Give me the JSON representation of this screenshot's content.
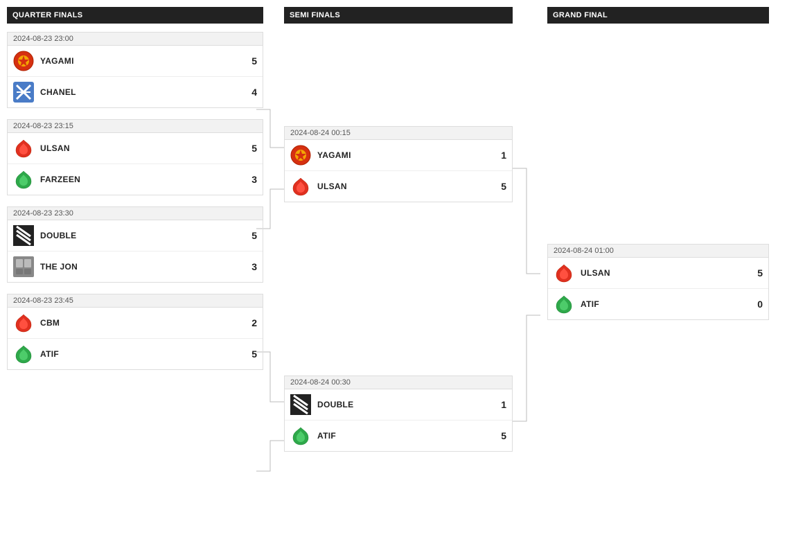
{
  "rounds": {
    "qf": {
      "label": "Quarter Finals",
      "matches": [
        {
          "time": "2024-08-23 23:00",
          "teams": [
            {
              "name": "YAGAMI",
              "score": "5",
              "logo": "yagami"
            },
            {
              "name": "CHANEL",
              "score": "4",
              "logo": "chanel"
            }
          ]
        },
        {
          "time": "2024-08-23 23:15",
          "teams": [
            {
              "name": "ULSAN",
              "score": "5",
              "logo": "ulsan"
            },
            {
              "name": "FARZEEN",
              "score": "3",
              "logo": "farzeen"
            }
          ]
        },
        {
          "time": "2024-08-23 23:30",
          "teams": [
            {
              "name": "DOUBLE",
              "score": "5",
              "logo": "double"
            },
            {
              "name": "THE JON",
              "score": "3",
              "logo": "thejon"
            }
          ]
        },
        {
          "time": "2024-08-23 23:45",
          "teams": [
            {
              "name": "CBM",
              "score": "2",
              "logo": "cbm"
            },
            {
              "name": "ATIF",
              "score": "5",
              "logo": "atif"
            }
          ]
        }
      ]
    },
    "sf": {
      "label": "Semi Finals",
      "matches": [
        {
          "time": "2024-08-24 00:15",
          "teams": [
            {
              "name": "YAGAMI",
              "score": "1",
              "logo": "yagami"
            },
            {
              "name": "ULSAN",
              "score": "5",
              "logo": "ulsan"
            }
          ]
        },
        {
          "time": "2024-08-24 00:30",
          "teams": [
            {
              "name": "DOUBLE",
              "score": "1",
              "logo": "double"
            },
            {
              "name": "ATIF",
              "score": "5",
              "logo": "atif"
            }
          ]
        }
      ]
    },
    "gf": {
      "label": "Grand Final",
      "matches": [
        {
          "time": "2024-08-24 01:00",
          "teams": [
            {
              "name": "ULSAN",
              "score": "5",
              "logo": "ulsan"
            },
            {
              "name": "ATIF",
              "score": "0",
              "logo": "atif"
            }
          ]
        }
      ]
    }
  }
}
